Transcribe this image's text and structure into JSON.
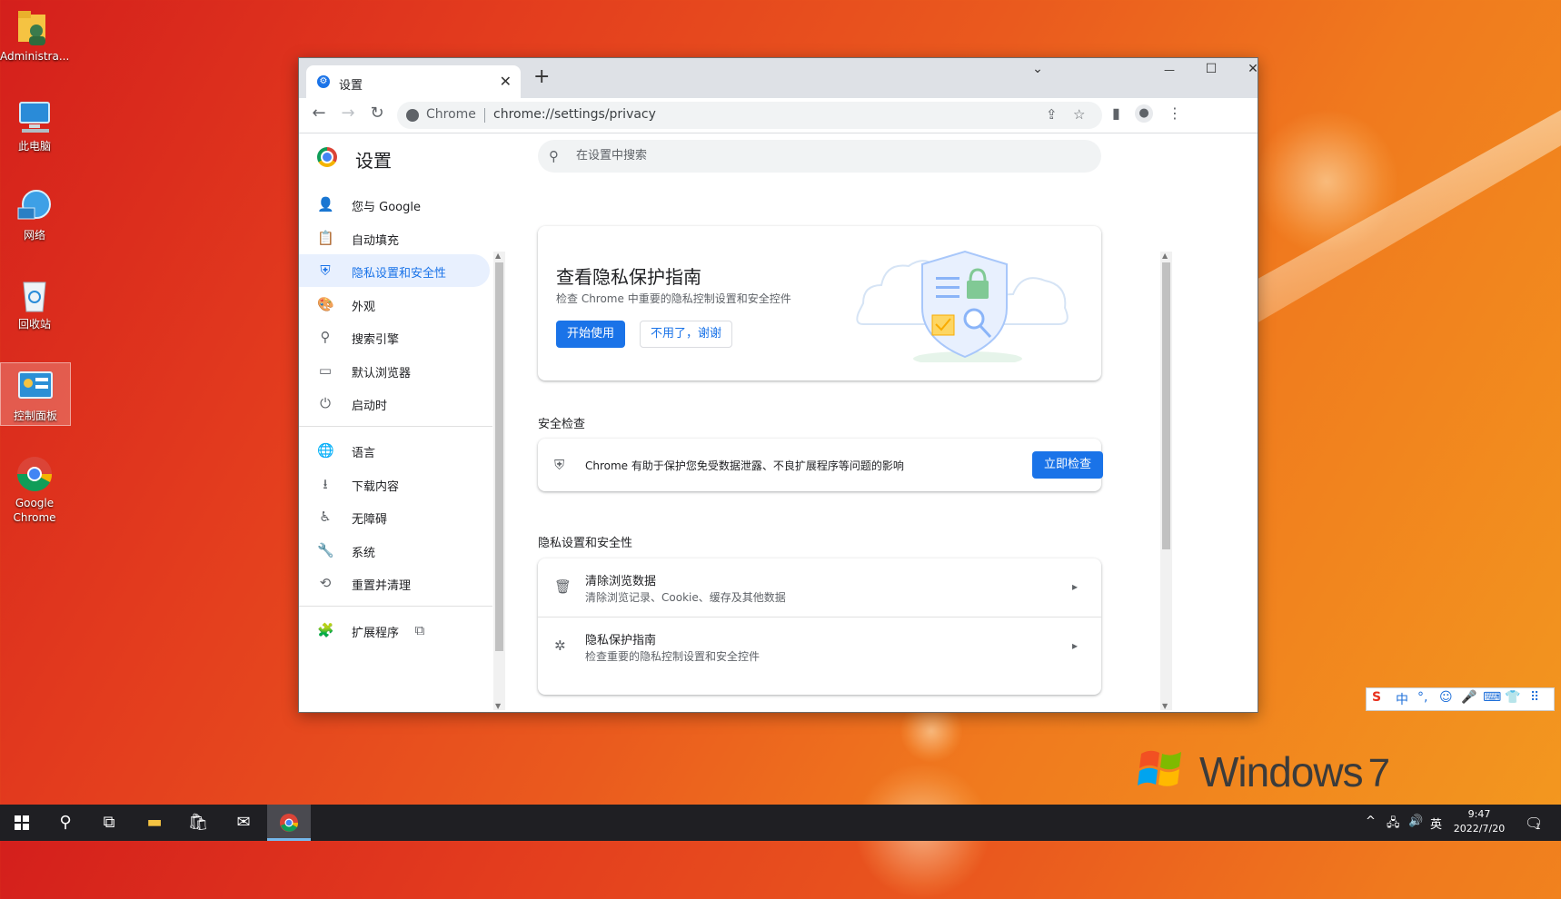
{
  "desktop": {
    "icons": [
      {
        "label": "Administra..."
      },
      {
        "label": "此电脑"
      },
      {
        "label": "网络"
      },
      {
        "label": "回收站"
      },
      {
        "label": "控制面板"
      },
      {
        "label": "Google Chrome"
      }
    ],
    "brand": "Windows",
    "brand_version": "7"
  },
  "browser": {
    "tab_title": "设置",
    "tab_close": "✕",
    "new_tab": "+",
    "window_controls": {
      "tabsearch": "⌄",
      "minimize": "—",
      "maximize": "☐",
      "close": "✕"
    },
    "omnibox": {
      "chip": "Chrome",
      "url": "chrome://settings/privacy"
    }
  },
  "settings": {
    "title": "设置",
    "search_placeholder": "在设置中搜索",
    "sidebar": [
      {
        "label": "您与 Google",
        "icon": "person-icon"
      },
      {
        "label": "自动填充",
        "icon": "clipboard-icon"
      },
      {
        "label": "隐私设置和安全性",
        "icon": "shield-icon",
        "active": true
      },
      {
        "label": "外观",
        "icon": "palette-icon"
      },
      {
        "label": "搜索引擎",
        "icon": "search-icon"
      },
      {
        "label": "默认浏览器",
        "icon": "browser-icon"
      },
      {
        "label": "启动时",
        "icon": "power-icon"
      },
      {
        "label": "语言",
        "icon": "globe-icon"
      },
      {
        "label": "下载内容",
        "icon": "download-icon"
      },
      {
        "label": "无障碍",
        "icon": "accessibility-icon"
      },
      {
        "label": "系统",
        "icon": "wrench-icon"
      },
      {
        "label": "重置并清理",
        "icon": "history-icon"
      },
      {
        "label": "扩展程序",
        "icon": "puzzle-icon"
      }
    ],
    "guide_card": {
      "title": "查看隐私保护指南",
      "subtitle": "检查 Chrome 中重要的隐私控制设置和安全控件",
      "primary_button": "开始使用",
      "secondary_button": "不用了，谢谢"
    },
    "safety_check": {
      "heading": "安全检查",
      "text": "Chrome 有助于保护您免受数据泄露、不良扩展程序等问题的影响",
      "button": "立即检查"
    },
    "privacy_section": {
      "heading": "隐私设置和安全性",
      "rows": [
        {
          "title": "清除浏览数据",
          "subtitle": "清除浏览记录、Cookie、缓存及其他数据",
          "icon": "trash-icon"
        },
        {
          "title": "隐私保护指南",
          "subtitle": "检查重要的隐私控制设置和安全控件",
          "icon": "compass-icon"
        }
      ]
    }
  },
  "ime": {
    "items": [
      "S",
      "中",
      "°,",
      "☺",
      "🎤",
      "⌨",
      "👕",
      "⠿"
    ]
  },
  "taskbar": {
    "tray_lang": "英",
    "time": "9:47",
    "date": "2022/7/20",
    "notification_count": "1"
  }
}
